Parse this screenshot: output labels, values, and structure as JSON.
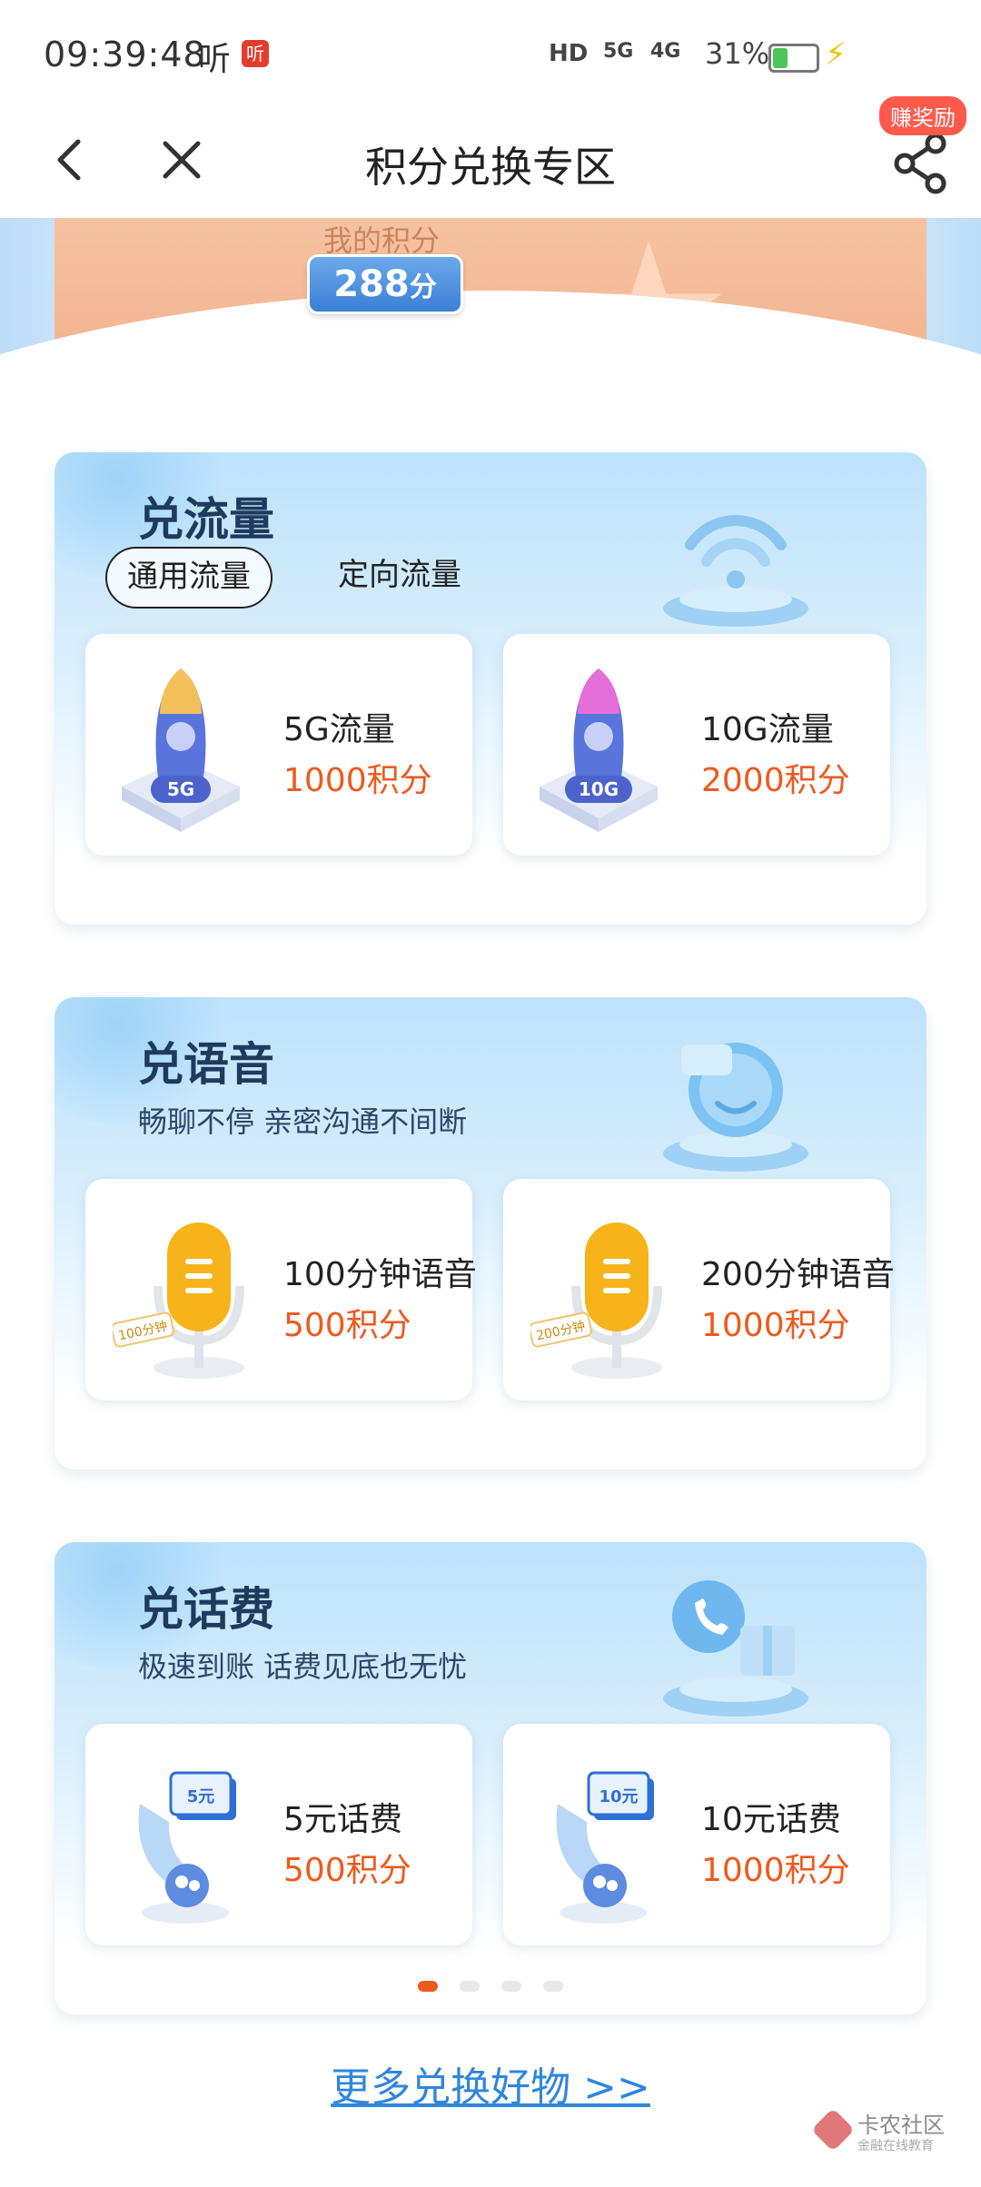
{
  "status_bar": {
    "time": "09:39:48",
    "app_label": "听",
    "app_badge": "听",
    "network_hd": "HD",
    "network_5g": "5G",
    "network_4g": "4G",
    "battery_percent": "31%"
  },
  "header": {
    "title": "积分兑换专区",
    "reward_badge": "赚奖励",
    "icons": [
      "back-icon",
      "close-icon",
      "share-icon"
    ]
  },
  "banner": {
    "label": "我的积分",
    "score_value": "288",
    "score_unit": "分"
  },
  "flow": {
    "title": "兑流量",
    "tabs": [
      "通用流量",
      "定向流量"
    ],
    "active_tab": "通用流量",
    "items": [
      {
        "badge": "5G",
        "name": "5G流量",
        "points": "1000积分"
      },
      {
        "badge": "10G",
        "name": "10G流量",
        "points": "2000积分"
      }
    ]
  },
  "voice": {
    "title": "兑语音",
    "subtitle": "畅聊不停  亲密沟通不间断",
    "items": [
      {
        "badge": "100分钟",
        "name": "100分钟语音",
        "points": "500积分"
      },
      {
        "badge": "200分钟",
        "name": "200分钟语音",
        "points": "1000积分"
      }
    ]
  },
  "fee": {
    "title": "兑话费",
    "subtitle": "极速到账  话费见底也无忧",
    "items": [
      {
        "badge": "5元",
        "name": "5元话费",
        "points": "500积分"
      },
      {
        "badge": "10元",
        "name": "10元话费",
        "points": "1000积分"
      }
    ],
    "pagination": {
      "total": 4,
      "active": 0
    }
  },
  "footer": {
    "more_link": "更多兑换好物 >>",
    "watermark_title": "卡农社区",
    "watermark_sub": "金融在线教育"
  },
  "colors": {
    "accent_orange": "#ee5a1c",
    "link_blue": "#2e86de",
    "score_blue": "#3b7fd6",
    "reward_red": "#ff5a4c"
  }
}
